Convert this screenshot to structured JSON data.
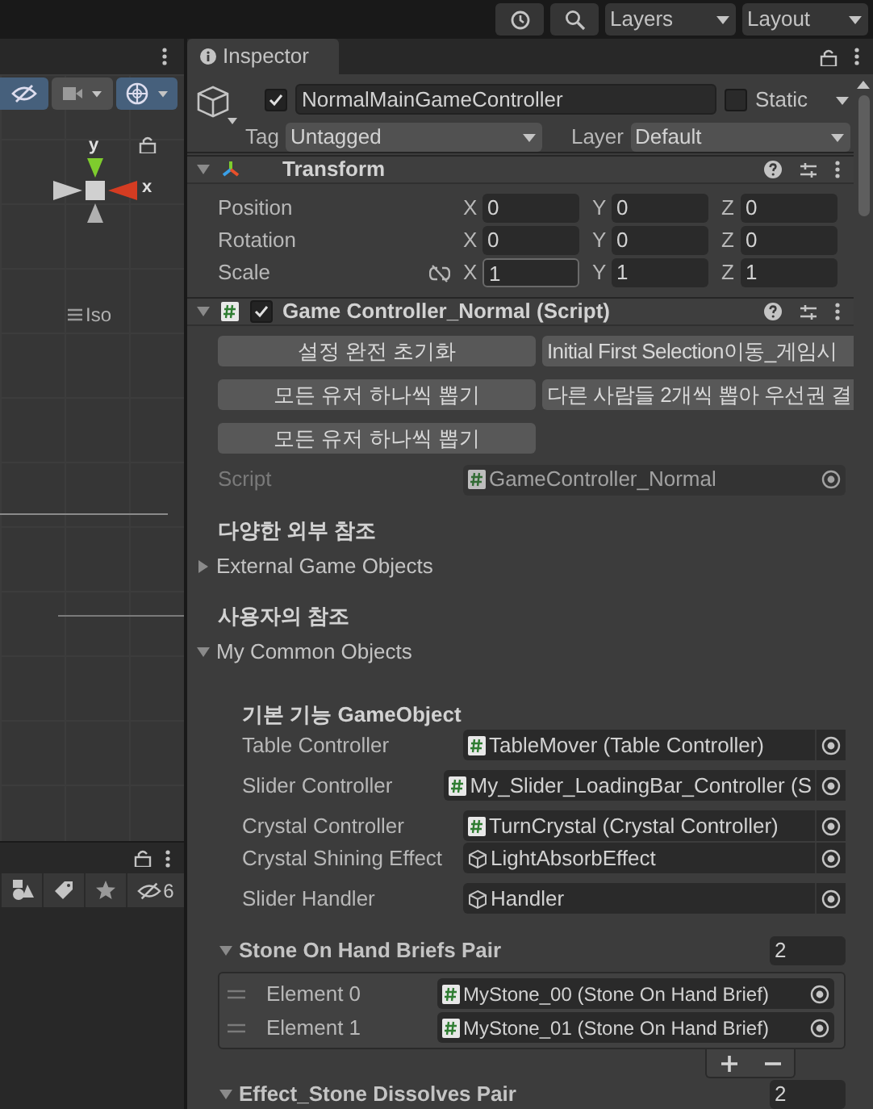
{
  "toolbar": {
    "dropdowns": [
      "Layers",
      "Layout"
    ]
  },
  "scene": {
    "visibility_on": true,
    "camera_on": false,
    "gizmos_on": true,
    "axis_y": "y",
    "axis_x": "x",
    "projection": "Iso"
  },
  "hierarchy": {
    "hidden_count": "6"
  },
  "inspector": {
    "tab": "Inspector",
    "object": {
      "active": true,
      "name": "NormalMainGameController",
      "static": false,
      "static_label": "Static",
      "tag_label": "Tag",
      "tag": "Untagged",
      "layer_label": "Layer",
      "layer": "Default"
    },
    "transform": {
      "title": "Transform",
      "expanded": true,
      "rows": [
        {
          "label": "Position",
          "fields": [
            {
              "axis": "X",
              "value": "0"
            },
            {
              "axis": "Y",
              "value": "0"
            },
            {
              "axis": "Z",
              "value": "0"
            }
          ]
        },
        {
          "label": "Rotation",
          "fields": [
            {
              "axis": "X",
              "value": "0"
            },
            {
              "axis": "Y",
              "value": "0"
            },
            {
              "axis": "Z",
              "value": "0"
            }
          ]
        },
        {
          "label": "Scale",
          "fields": [
            {
              "axis": "X",
              "value": "1"
            },
            {
              "axis": "Y",
              "value": "1"
            },
            {
              "axis": "Z",
              "value": "1"
            }
          ]
        }
      ]
    },
    "script_component": {
      "title": "Game Controller_Normal (Script)",
      "enabled": true,
      "expanded": true,
      "buttons": [
        "설정 완전 초기화",
        "Initial First Selection이동_게임시",
        "모든 유저 하나씩 뽑기",
        "다른 사람들 2개씩 뽑아 우선권 결",
        "모든 유저 하나씩 뽑기"
      ],
      "script": {
        "label": "Script",
        "value": "GameController_Normal"
      },
      "sections": [
        {
          "header": "다양한 외부 참조",
          "foldout": "External Game Objects",
          "expanded": false
        },
        {
          "header": "사용자의 참조",
          "foldout": "My Common Objects",
          "expanded": true,
          "subheader": "기본 기능 GameObject",
          "fields": [
            {
              "label": "Table Controller",
              "value": "TableMover (Table Controller)",
              "kind": "script"
            },
            {
              "label": "Slider Controller",
              "value": "My_Slider_LoadingBar_Controller (S",
              "kind": "script"
            },
            {
              "label": "Crystal Controller",
              "value": "TurnCrystal (Crystal Controller)",
              "kind": "script"
            },
            {
              "label": "Crystal Shining Effect",
              "value": "LightAbsorbEffect",
              "kind": "object"
            },
            {
              "label": "Slider Handler",
              "value": "Handler",
              "kind": "object"
            }
          ]
        }
      ],
      "lists": [
        {
          "title": "Stone On Hand Briefs Pair",
          "expanded": true,
          "count": "2",
          "elements": [
            {
              "label": "Element 0",
              "value": "MyStone_00 (Stone On Hand Brief)"
            },
            {
              "label": "Element 1",
              "value": "MyStone_01 (Stone On Hand Brief)"
            }
          ]
        },
        {
          "title": "Effect_Stone Dissolves Pair",
          "expanded": true,
          "count": "2"
        }
      ]
    }
  }
}
